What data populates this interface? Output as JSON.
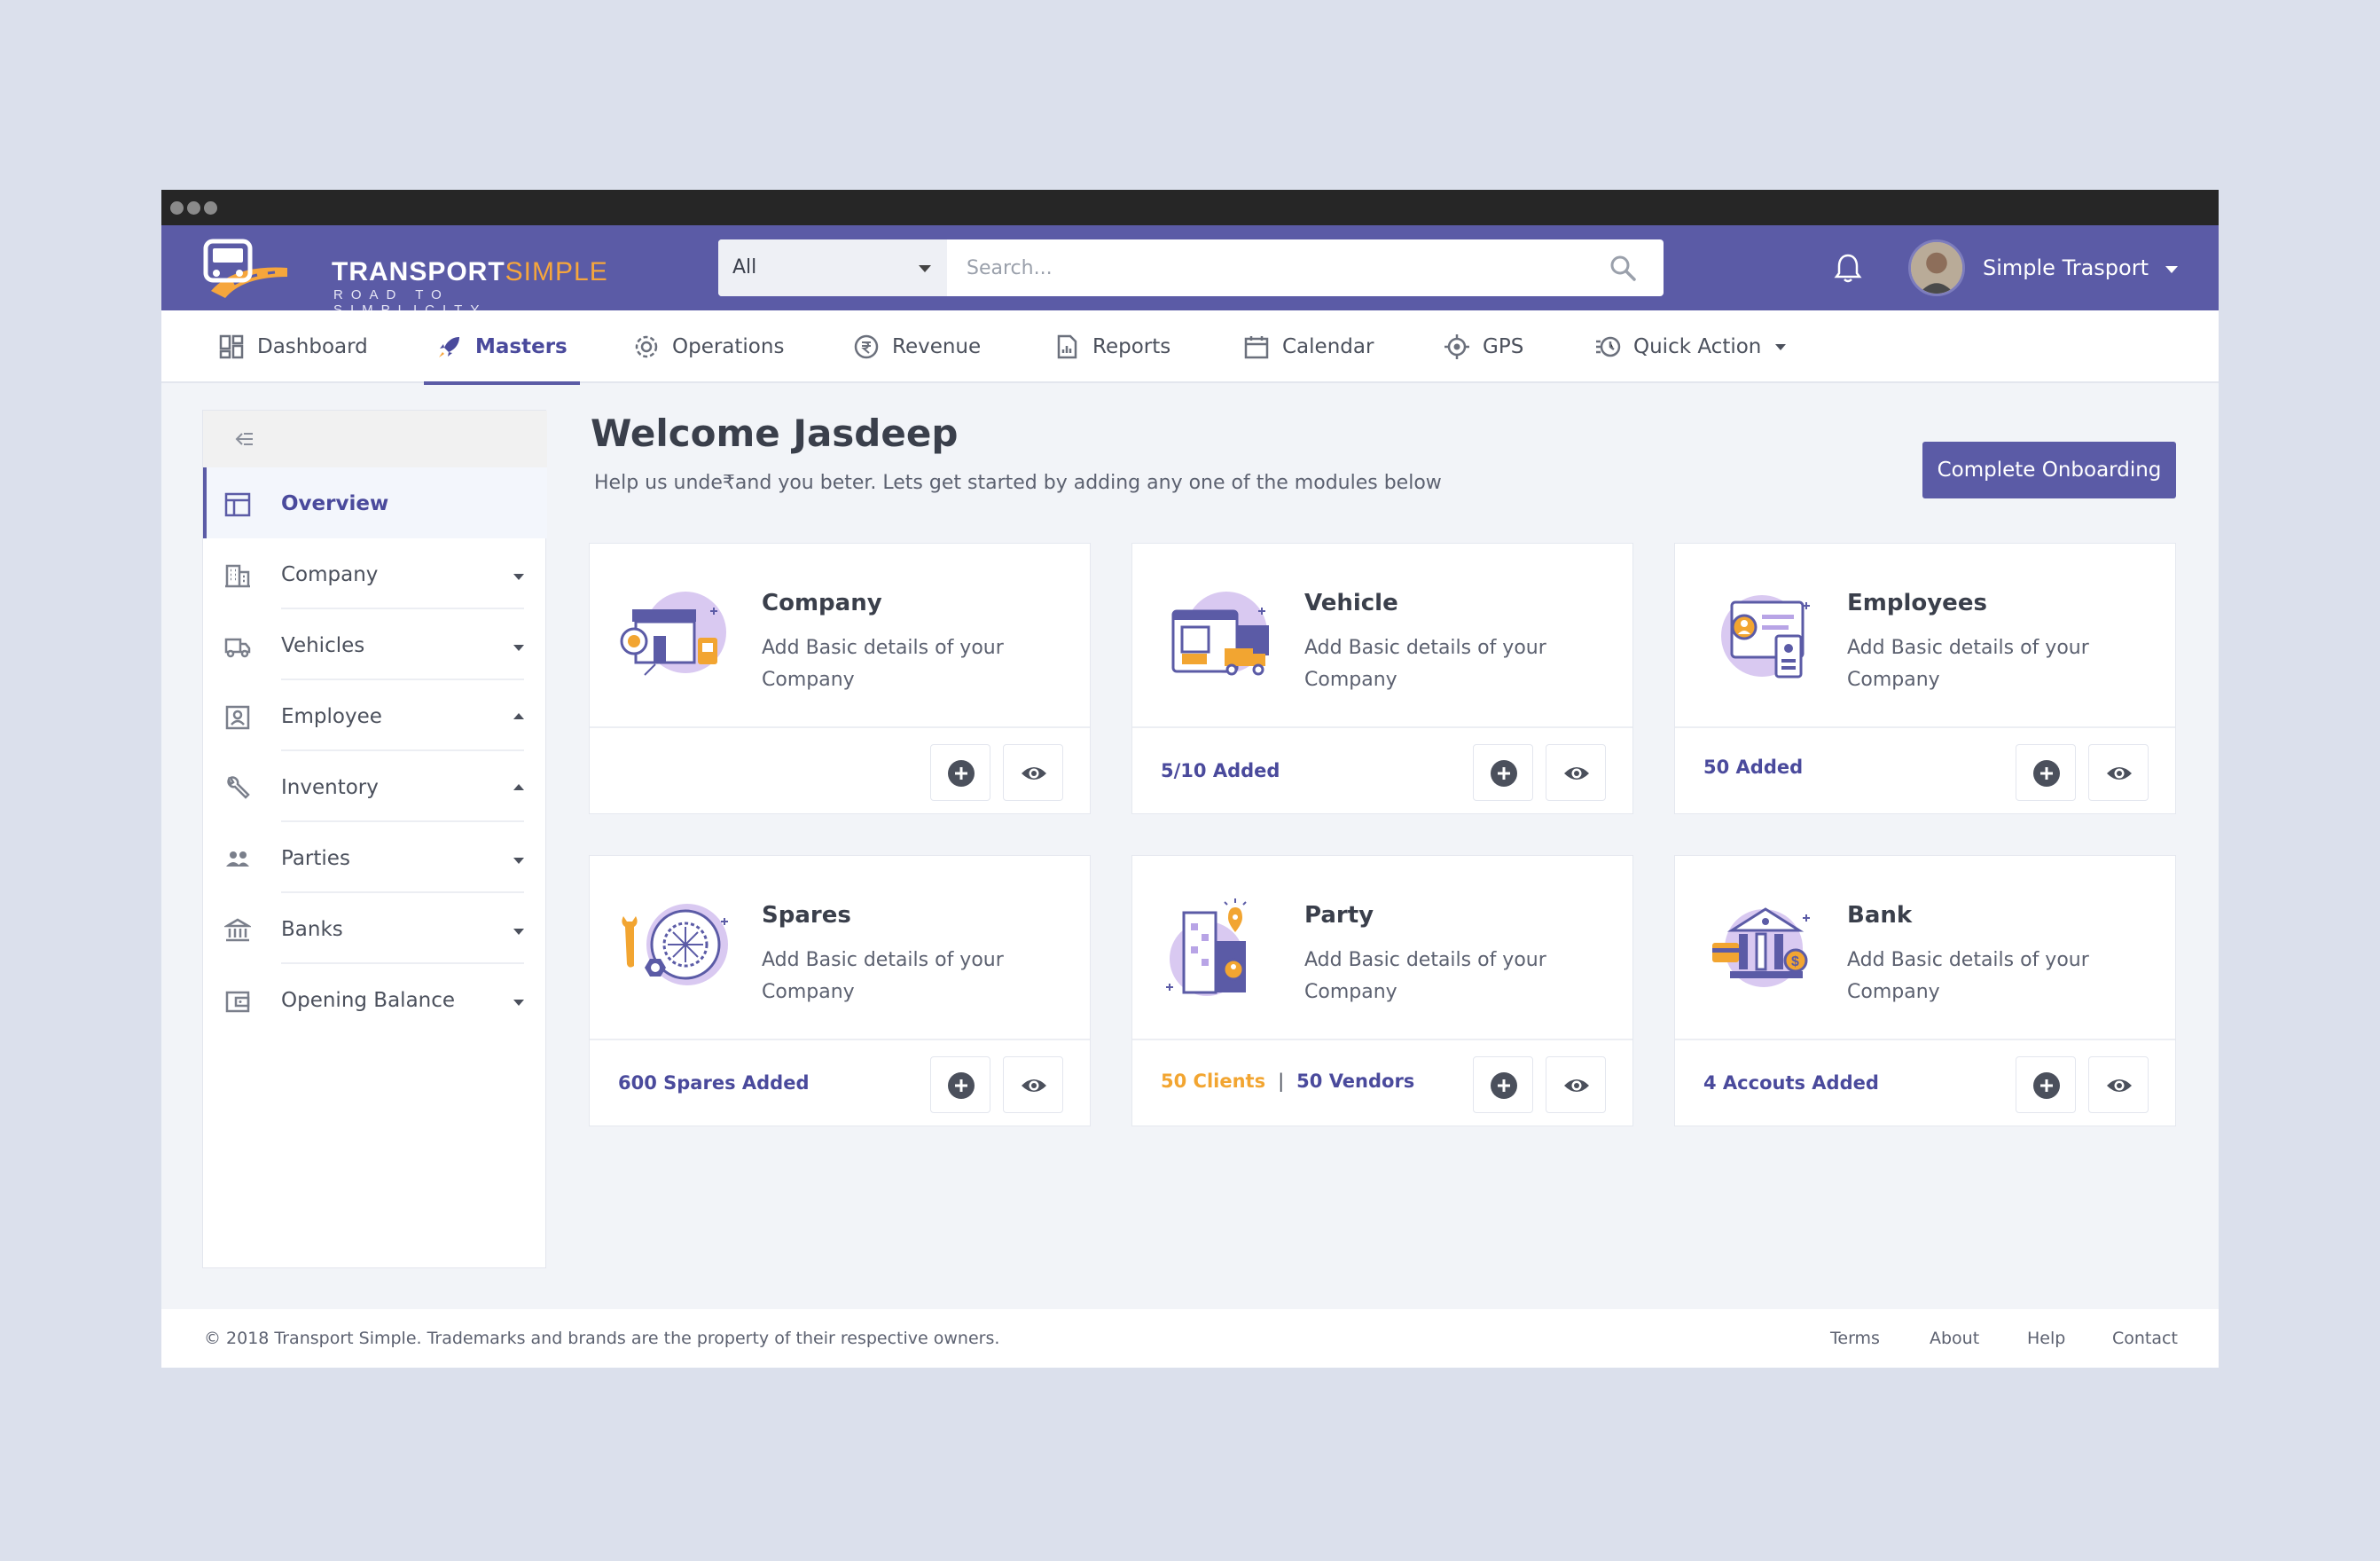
{
  "app": {
    "logo_main": "TRANSPORT",
    "logo_accent": "SIMPLE",
    "logo_tagline": "ROAD TO SIMPLICITY"
  },
  "search": {
    "category": "All",
    "placeholder": "Search..."
  },
  "user": {
    "name": "Simple Trasport"
  },
  "nav": [
    {
      "label": "Dashboard",
      "icon": "dashboard-icon"
    },
    {
      "label": "Masters",
      "icon": "rocket-icon",
      "active": true
    },
    {
      "label": "Operations",
      "icon": "gear-icon"
    },
    {
      "label": "Revenue",
      "icon": "rupee-icon"
    },
    {
      "label": "Reports",
      "icon": "report-icon"
    },
    {
      "label": "Calendar",
      "icon": "calendar-icon"
    },
    {
      "label": "GPS",
      "icon": "gps-icon"
    },
    {
      "label": "Quick Action",
      "icon": "history-icon"
    }
  ],
  "sidebar": [
    {
      "label": "Overview",
      "icon": "table-icon",
      "active": true
    },
    {
      "label": "Company",
      "icon": "building-icon",
      "caret": "down"
    },
    {
      "label": "Vehicles",
      "icon": "truck-icon",
      "caret": "down"
    },
    {
      "label": "Employee",
      "icon": "id-card-icon",
      "caret": "up"
    },
    {
      "label": "Inventory",
      "icon": "wrench-icon",
      "caret": "up"
    },
    {
      "label": "Parties",
      "icon": "people-icon",
      "caret": "down"
    },
    {
      "label": "Banks",
      "icon": "bank-icon",
      "caret": "down"
    },
    {
      "label": "Opening Balance",
      "icon": "wallet-icon",
      "caret": "down"
    }
  ],
  "main": {
    "welcome": "Welcome Jasdeep",
    "subtitle": "Help us unde₹and you beter. Lets get started by adding any one of the modules below",
    "onboarding_button": "Complete Onboarding"
  },
  "cards": [
    {
      "title": "Company",
      "desc": "Add Basic details of your Company",
      "count": "",
      "illustration": "company-illustration"
    },
    {
      "title": "Vehicle",
      "desc": "Add Basic details of your Company",
      "count": "5/10 Added",
      "illustration": "vehicle-illustration"
    },
    {
      "title": "Employees",
      "desc": "Add Basic details of your Company",
      "count": "50 Added",
      "illustration": "employees-illustration"
    },
    {
      "title": "Spares",
      "desc": "Add Basic details of your Company",
      "count": "600 Spares Added",
      "illustration": "spares-illustration"
    },
    {
      "title": "Party",
      "desc": "Add Basic details of your Company",
      "count_clients": "50 Clients",
      "count_sep": "|",
      "count_vendors": "50 Vendors",
      "illustration": "party-illustration"
    },
    {
      "title": "Bank",
      "desc": "Add Basic details of your Company",
      "count": "4 Accouts Added",
      "illustration": "bank-illustration"
    }
  ],
  "footer": {
    "copyright": "© 2018 Transport Simple. Trademarks and brands are the property of their respective owners.",
    "links": [
      "Terms",
      "About",
      "Help",
      "Contact"
    ]
  },
  "colors": {
    "brand": "#5b5ba6",
    "accent_orange": "#f6a63c",
    "background": "#dbe0ec"
  }
}
